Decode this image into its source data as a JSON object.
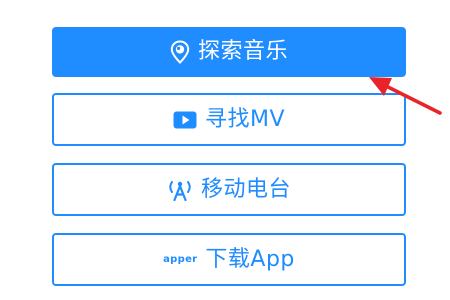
{
  "menu": {
    "explore": {
      "label": "探索音乐",
      "icon": "location-pin-icon"
    },
    "find_mv": {
      "label": "寻找MV",
      "icon": "video-play-icon"
    },
    "radio": {
      "label": "移动电台",
      "icon": "radio-tower-icon"
    },
    "download": {
      "label": "下载App",
      "icon_text": "apper"
    }
  },
  "colors": {
    "accent": "#1f8cff",
    "annotation": "#e8232a",
    "background": "#ffffff"
  }
}
